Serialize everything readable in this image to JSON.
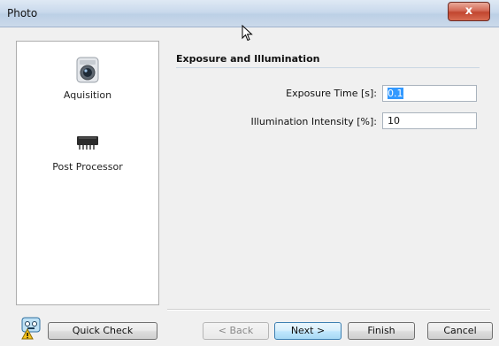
{
  "window": {
    "title": "Photo",
    "close_label": "x"
  },
  "sidebar": {
    "items": [
      {
        "label": "Aquisition",
        "icon": "camera-icon",
        "selected": true
      },
      {
        "label": "Post Processor",
        "icon": "chip-icon",
        "selected": false
      }
    ]
  },
  "section": {
    "title": "Exposure and Illumination"
  },
  "fields": {
    "exposure": {
      "label": "Exposure Time [s]:",
      "value": "0.1"
    },
    "illumination": {
      "label": "Illumination Intensity [%]:",
      "value": "10"
    }
  },
  "buttons": {
    "quick_check": "Quick Check",
    "back": "< Back",
    "next": "Next >",
    "finish": "Finish",
    "cancel": "Cancel"
  },
  "colors": {
    "close_red": "#c2462f",
    "next_blue": "#3c7fb1",
    "selection": "#3399ff"
  }
}
